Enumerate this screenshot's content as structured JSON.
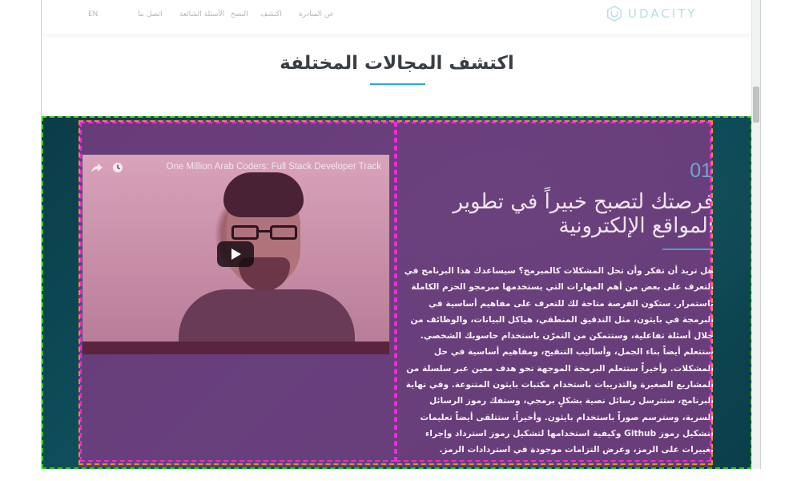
{
  "header": {
    "logo_text": "UDACITY",
    "nav": [
      "عن المبادرة",
      "اكتشف",
      "النصح",
      "الأسئلة الشائعة",
      "اتصل بنا",
      "EN"
    ]
  },
  "section": {
    "title": "اكتشف المجالات المختلفة"
  },
  "feature": {
    "number": "01",
    "heading": "فرصتك لتصبح خبيراً في تطوير المواقع الإلكترونية",
    "body": "هل تريد أن تفكر وأن تحل المشكلات كالمبرمج؟ سيساعدك هذا البرنامج في التعرف على بعض من أهم المهارات التي يستخدمها مبرمجو الحزم الكاملة باستمرار. ستكون الفرصة متاحة لك للتعرف على مفاهيم أساسية في البرمجة في بايثون، مثل التدقيق المنطقي، هياكل البيانات، والوظائف من خلال أسئلة تفاعلية، وستتمكن من التمرّن باستخدام حاسوبك الشخصي. ستتعلم أيضاً بناء الجمل، وأساليب التنقيح، ومفاهيم أساسية في حل المشكلات. وأخيراً ستتعلم البرمجة الموجهة نحو هدف معين عبر سلسلة من المشاريع الصغيرة والتدريبات باستخدام مكتبات بايثون المتنوعة. وفي نهاية البرنامج، ستترسل رسائل نصية بشكلٍ برمجي، وستفك رموز الرسائل السرية، وسترسم صوراً باستخدام بايثون. وأخيراً، ستتلقى أيضاً تعليمات لتشكيل رموز Github وكيفية استخدامها لتشكيل رموز استرداد وإجراء تغييرات على الرمز، وعرض التزامات موجودة في استردادات الرمز."
  },
  "video": {
    "title": "One Million Arab Coders: Full Stack Developer Track"
  },
  "colors": {
    "overlay": "#7d3c82",
    "accent": "#2aa8c9",
    "section_bg": "#0f5360"
  },
  "icons": [
    "udacity-logo-icon",
    "share-icon",
    "watch-later-icon",
    "play-icon"
  ]
}
